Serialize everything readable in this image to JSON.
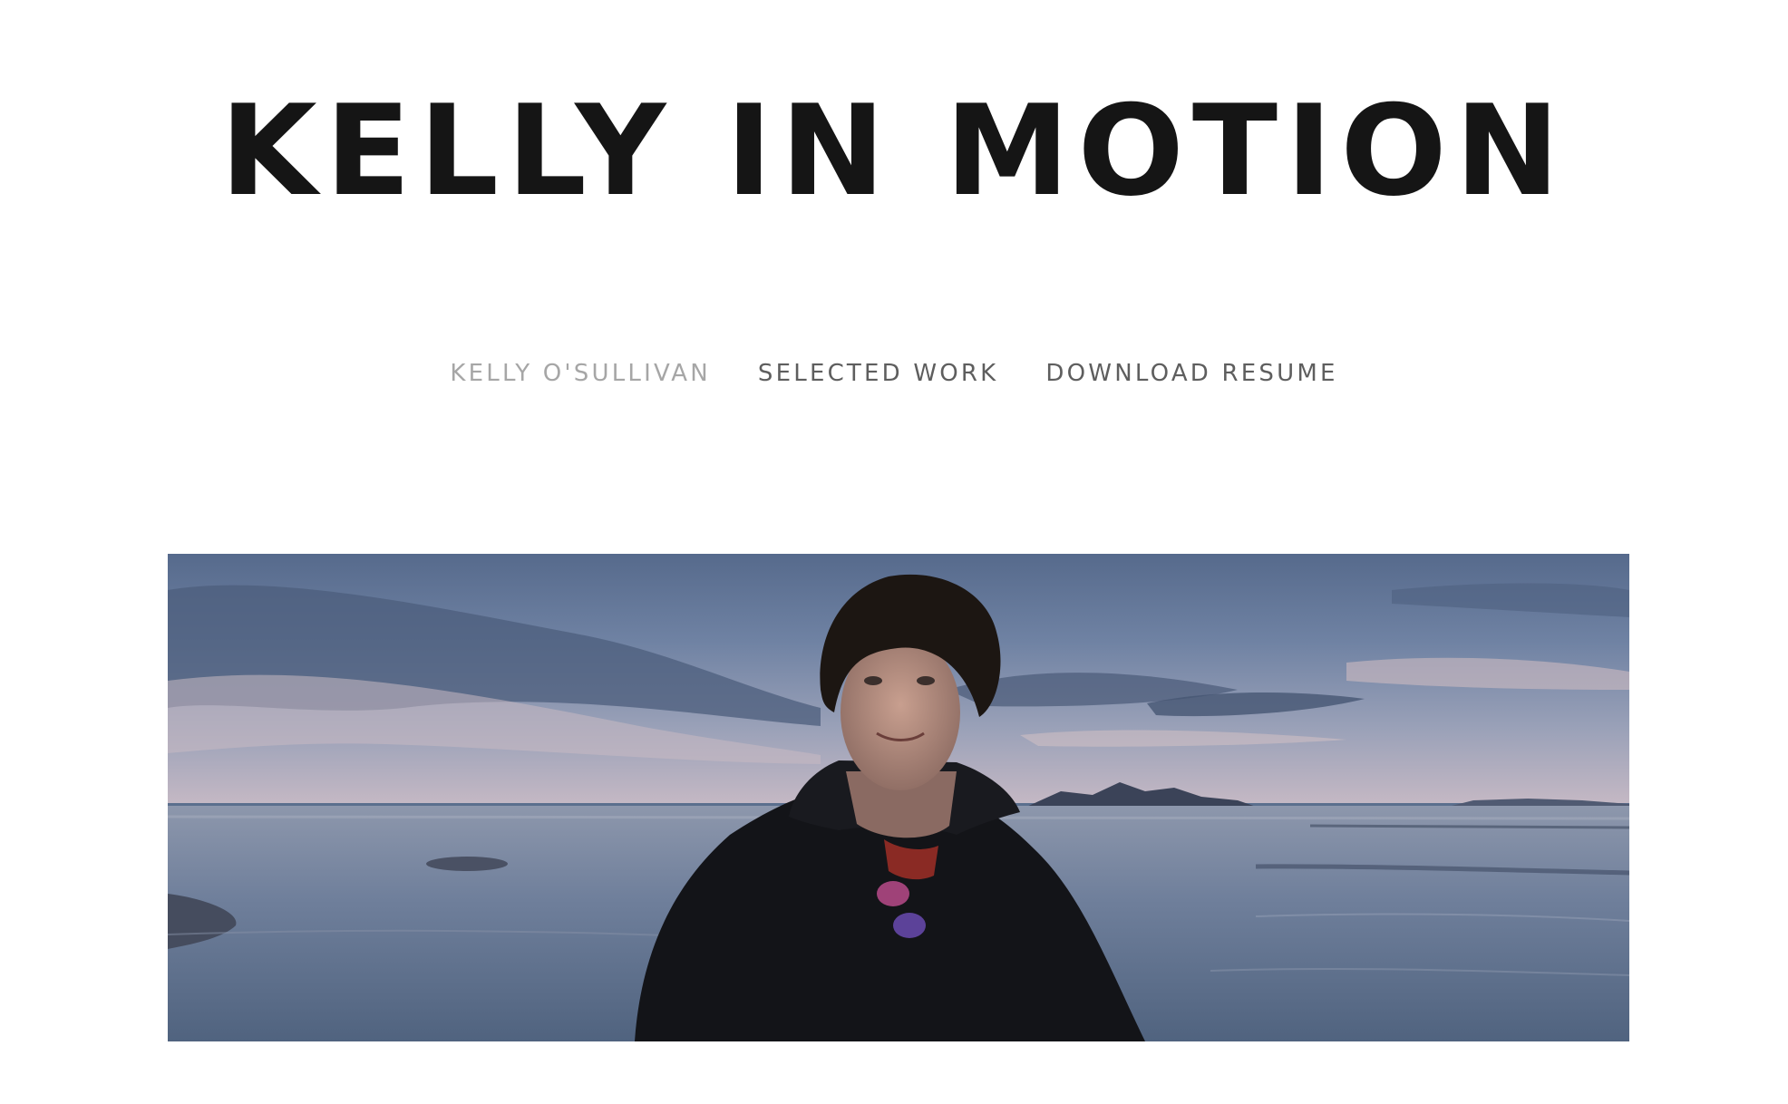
{
  "site": {
    "title": "KELLY IN MOTION"
  },
  "nav": {
    "items": [
      {
        "label": "KELLY O'SULLIVAN",
        "active": true
      },
      {
        "label": "SELECTED WORK",
        "active": false
      },
      {
        "label": "DOWNLOAD RESUME",
        "active": false
      }
    ]
  },
  "hero": {
    "image": "portrait-photo",
    "colors": {
      "sky_top": "#5a6f93",
      "sky_horizon": "#b9b3c0",
      "water": "#6d7f9a",
      "jacket": "#14151a",
      "hair": "#1a1512"
    }
  }
}
